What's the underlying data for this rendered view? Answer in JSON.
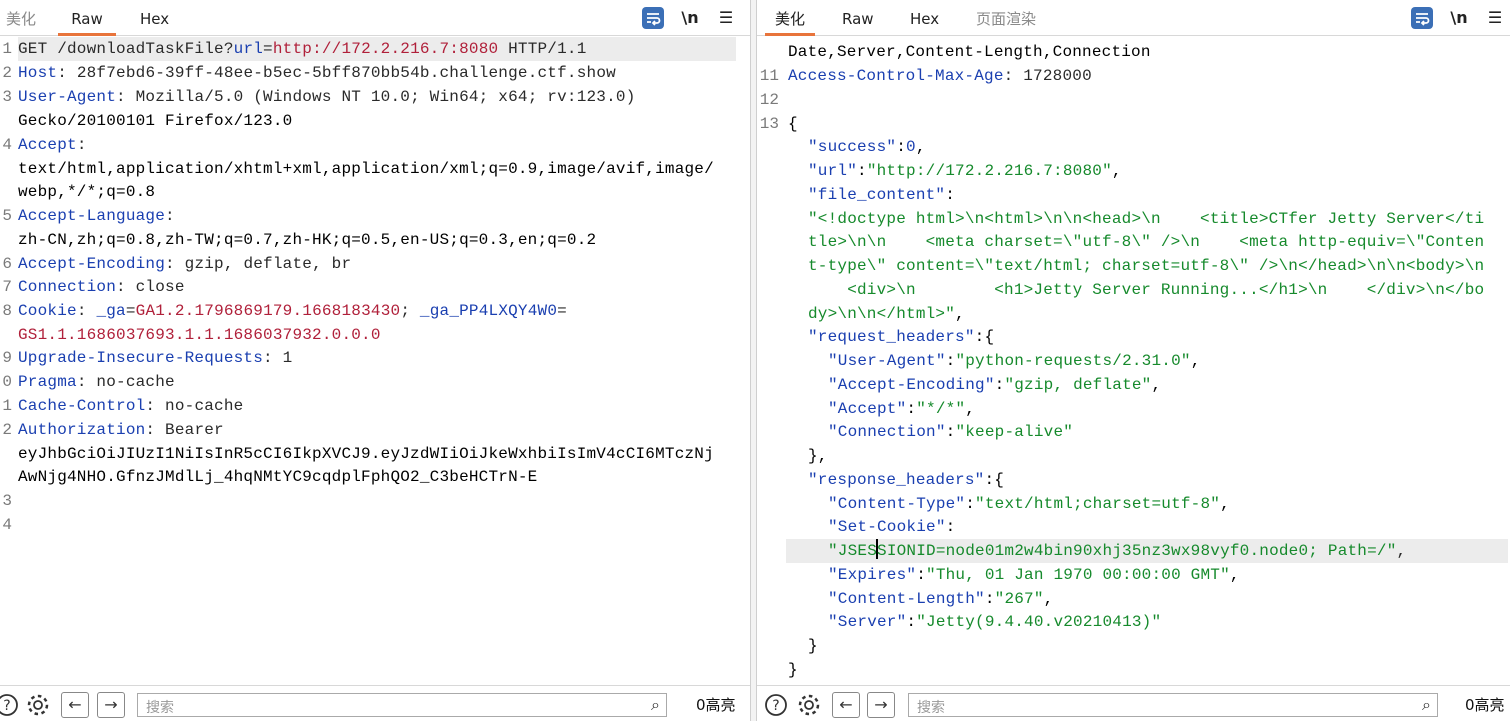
{
  "left": {
    "tabs": [
      {
        "label": "美化"
      },
      {
        "label": "Raw",
        "active": true
      },
      {
        "label": "Hex"
      }
    ],
    "toolbar": {
      "wrap_icon": "wrap-lines-icon",
      "newline_label": "\\n",
      "menu_icon": "hamburger-menu-icon"
    },
    "request_line": {
      "method": "GET /downloadTaskFile?",
      "param": "url",
      "eq": "=",
      "value": "http://172.2.216.7:8080",
      "proto": " HTTP/1.1"
    },
    "headers": {
      "host": {
        "name": "Host",
        "value": " 28f7ebd6-39ff-48ee-b5ec-5bff870bb54b.challenge.ctf.show"
      },
      "ua": {
        "name": "User-Agent",
        "value": " Mozilla/5.0 (Windows NT 10.0; Win64; x64; rv:123.0)",
        "value2": "Gecko/20100101 Firefox/123.0"
      },
      "accept": {
        "name": "Accept",
        "value": "text/html,application/xhtml+xml,application/xml;q=0.9,image/avif,image/",
        "value2": "webp,*/*;q=0.8"
      },
      "lang": {
        "name": "Accept-Language",
        "value": "zh-CN,zh;q=0.8,zh-TW;q=0.7,zh-HK;q=0.5,en-US;q=0.3,en;q=0.2"
      },
      "enc": {
        "name": "Accept-Encoding",
        "value": " gzip, deflate, br"
      },
      "conn": {
        "name": "Connection",
        "value": " close"
      },
      "cookie": {
        "name": "Cookie",
        "sep": " ",
        "k1": "_ga",
        "eq": "=",
        "v1": "GA1.2.1796869179.1668183430",
        "semi": "; ",
        "k2": "_ga_PP4LXQY4W0",
        "v2": "GS1.1.1686037693.1.1.1686037932.0.0.0"
      },
      "uir": {
        "name": "Upgrade-Insecure-Requests",
        "value": " 1"
      },
      "pragma": {
        "name": "Pragma",
        "value": " no-cache"
      },
      "cc": {
        "name": "Cache-Control",
        "value": " no-cache"
      },
      "auth": {
        "name": "Authorization",
        "value": " Bearer",
        "value2": "eyJhbGciOiJIUzI1NiIsInR5cCI6IkpXVCJ9.eyJzdWIiOiJkeWxhbiIsImV4cCI6MTczNj",
        "value3": "AwNjg4NHO.GfnzJMdlLj_4hqNMtYC9cqdplFphQO2_C3beHCTrN-E"
      }
    },
    "line_numbers": [
      "1",
      "2",
      "3",
      "",
      "4",
      "",
      "",
      "5",
      "",
      "6",
      "7",
      "8",
      "",
      "9",
      "0",
      "1",
      "2",
      "",
      "",
      "3",
      "4"
    ],
    "bottom": {
      "help_icon": "help-icon",
      "settings_icon": "gear-icon",
      "back_icon": "arrow-left-icon",
      "forward_icon": "arrow-right-icon",
      "search_placeholder": "搜索",
      "search_icon": "search-icon",
      "highlight_count": "0高亮"
    }
  },
  "right": {
    "tabs": [
      {
        "label": "美化",
        "active": true
      },
      {
        "label": "Raw"
      },
      {
        "label": "Hex"
      },
      {
        "label": "页面渲染"
      }
    ],
    "toolbar": {
      "wrap_icon": "wrap-lines-icon",
      "newline_label": "\\n",
      "menu_icon": "hamburger-menu-icon"
    },
    "top_partial": "Date,Server,Content-Length,Connection",
    "line_numbers": [
      "11",
      "12",
      "13"
    ],
    "access_control": {
      "name": "Access-Control-Max-Age",
      "value": " 1728000"
    },
    "json": {
      "open": "{",
      "success_key": "\"success\"",
      "success_val": "0",
      "url_key": "\"url\"",
      "url_val": "\"http://172.2.216.7:8080\"",
      "file_content_key": "\"file_content\"",
      "file_content_lines": [
        "\"<!doctype html>\\n<html>\\n\\n<head>\\n    <title>CTfer Jetty Server</ti",
        "tle>\\n\\n    <meta charset=\\\"utf-8\\\" />\\n    <meta http-equiv=\\\"Conten",
        "t-type\\\" content=\\\"text/html; charset=utf-8\\\" />\\n</head>\\n\\n<body>\\n",
        "    <div>\\n        <h1>Jetty Server Running...</h1>\\n    </div>\\n</bo",
        "dy>\\n\\n</html>\""
      ],
      "request_headers_key": "\"request_headers\"",
      "rq_ua_key": "\"User-Agent\"",
      "rq_ua_val": "\"python-requests/2.31.0\"",
      "rq_ae_key": "\"Accept-Encoding\"",
      "rq_ae_val": "\"gzip, deflate\"",
      "rq_acc_key": "\"Accept\"",
      "rq_acc_val": "\"*/*\"",
      "rq_conn_key": "\"Connection\"",
      "rq_conn_val": "\"keep-alive\"",
      "response_headers_key": "\"response_headers\"",
      "rs_ct_key": "\"Content-Type\"",
      "rs_ct_val": "\"text/html;charset=utf-8\"",
      "rs_sc_key": "\"Set-Cookie\"",
      "rs_sc_val_a": "\"JSES",
      "rs_sc_val_b": "SIONID=node01m2w4bin90xhj35nz3wx98vyf0.node0; Path=/\"",
      "rs_exp_key": "\"Expires\"",
      "rs_exp_val": "\"Thu, 01 Jan 1970 00:00:00 GMT\"",
      "rs_cl_key": "\"Content-Length\"",
      "rs_cl_val": "\"267\"",
      "rs_srv_key": "\"Server\"",
      "rs_srv_val": "\"Jetty(9.4.40.v20210413)\"",
      "close_inner": "}",
      "close_outer": "}"
    },
    "bottom": {
      "help_icon": "help-icon",
      "settings_icon": "gear-icon",
      "back_icon": "arrow-left-icon",
      "forward_icon": "arrow-right-icon",
      "search_placeholder": "搜索",
      "search_icon": "search-icon",
      "highlight_count": "0高亮"
    }
  }
}
